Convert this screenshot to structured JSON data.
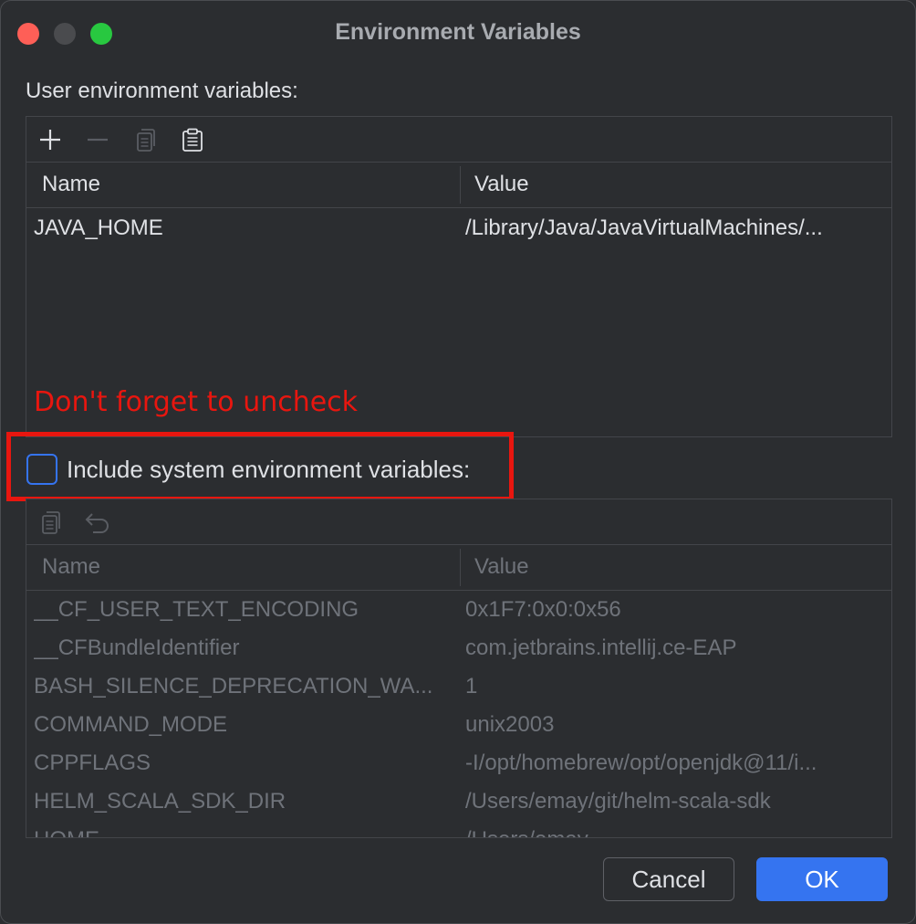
{
  "window": {
    "title": "Environment Variables"
  },
  "user_section": {
    "label": "User environment variables:",
    "columns": {
      "name": "Name",
      "value": "Value"
    },
    "rows": [
      {
        "name": "JAVA_HOME",
        "value": "/Library/Java/JavaVirtualMachines/..."
      }
    ]
  },
  "annotation": {
    "text": "Don't forget to uncheck",
    "color": "#e8160f"
  },
  "include_system": {
    "label": "Include system environment variables:",
    "checked": false
  },
  "system_section": {
    "columns": {
      "name": "Name",
      "value": "Value"
    },
    "rows": [
      {
        "name": "__CF_USER_TEXT_ENCODING",
        "value": "0x1F7:0x0:0x56"
      },
      {
        "name": "__CFBundleIdentifier",
        "value": "com.jetbrains.intellij.ce-EAP"
      },
      {
        "name": "BASH_SILENCE_DEPRECATION_WA...",
        "value": "1"
      },
      {
        "name": "COMMAND_MODE",
        "value": "unix2003"
      },
      {
        "name": "CPPFLAGS",
        "value": "-I/opt/homebrew/opt/openjdk@11/i..."
      },
      {
        "name": "HELM_SCALA_SDK_DIR",
        "value": "/Users/emay/git/helm-scala-sdk"
      },
      {
        "name": "HOME",
        "value": "/Users/emay"
      }
    ]
  },
  "buttons": {
    "cancel": "Cancel",
    "ok": "OK"
  },
  "colors": {
    "accent": "#3574f0",
    "background": "#2b2d30",
    "annotation_red": "#e8160f"
  }
}
